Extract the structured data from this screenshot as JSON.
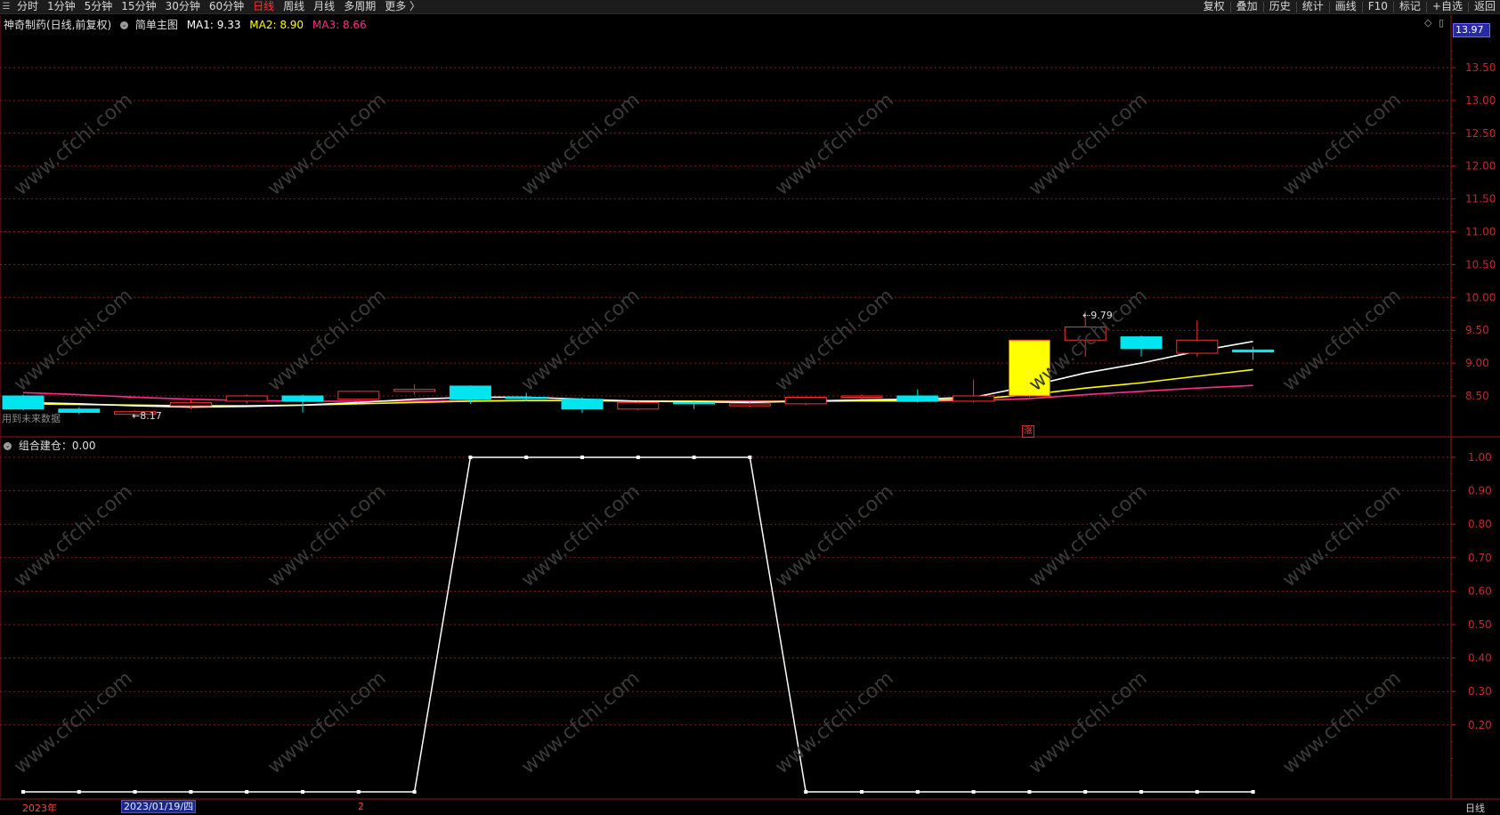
{
  "toolbar": {
    "periods": [
      "分时",
      "1分钟",
      "5分钟",
      "15分钟",
      "30分钟",
      "60分钟",
      "日线",
      "周线",
      "月线",
      "多周期",
      "更多 〉"
    ],
    "active_index": 6,
    "right_items": [
      "复权",
      "叠加",
      "历史",
      "统计",
      "画线",
      "F10",
      "标记",
      "+自选",
      "返回"
    ]
  },
  "main_panel": {
    "stock_title": "神奇制药(日线,前复权)",
    "chart_name": "简单主图",
    "ma1_label": "MA1: 9.33",
    "ma2_label": "MA2: 8.90",
    "ma3_label": "MA3: 8.66",
    "high_marker": "9.79",
    "low_marker": "8.17",
    "future_data_note": "用到未来数据",
    "current_price_tag": "13.97",
    "rise_tag": "涨",
    "colors": {
      "ma1": "#ffffff",
      "ma2": "#ffff00",
      "ma3": "#ff2a8a",
      "up": "#ff3030",
      "down": "#00e5ee",
      "limit_up": "#ffff00"
    }
  },
  "sub_panel": {
    "indicator_label": "组合建仓：0.00"
  },
  "bottom_bar": {
    "year_label": "2023年",
    "cursor_date": "2023/01/19/四",
    "marker_2": "2",
    "period_label": "日线"
  },
  "watermark": "www.cfchi.com",
  "chart_data": [
    {
      "type": "candlestick",
      "title": "神奇制药(日线,前复权)",
      "y_axis_ticks": [
        8.5,
        9.0,
        9.5,
        10.0,
        10.5,
        11.0,
        11.5,
        12.0,
        12.5,
        13.0,
        13.5
      ],
      "ylim": [
        8.0,
        14.0
      ],
      "candles": [
        {
          "o": 8.3,
          "c": 8.5,
          "h": 8.52,
          "l": 8.28,
          "dir": "down"
        },
        {
          "o": 8.3,
          "c": 8.25,
          "h": 8.33,
          "l": 8.22,
          "dir": "down"
        },
        {
          "o": 8.22,
          "c": 8.26,
          "h": 8.28,
          "l": 8.17,
          "dir": "up"
        },
        {
          "o": 8.35,
          "c": 8.4,
          "h": 8.45,
          "l": 8.3,
          "dir": "up"
        },
        {
          "o": 8.42,
          "c": 8.5,
          "h": 8.52,
          "l": 8.38,
          "dir": "up"
        },
        {
          "o": 8.5,
          "c": 8.42,
          "h": 8.52,
          "l": 8.25,
          "dir": "down"
        },
        {
          "o": 8.45,
          "c": 8.57,
          "h": 8.58,
          "l": 8.4,
          "dir": "up"
        },
        {
          "o": 8.57,
          "c": 8.6,
          "h": 8.68,
          "l": 8.52,
          "dir": "up"
        },
        {
          "o": 8.65,
          "c": 8.45,
          "h": 8.66,
          "l": 8.38,
          "dir": "down"
        },
        {
          "o": 8.48,
          "c": 8.46,
          "h": 8.55,
          "l": 8.42,
          "dir": "down"
        },
        {
          "o": 8.45,
          "c": 8.3,
          "h": 8.48,
          "l": 8.24,
          "dir": "down"
        },
        {
          "o": 8.3,
          "c": 8.4,
          "h": 8.42,
          "l": 8.28,
          "dir": "up"
        },
        {
          "o": 8.4,
          "c": 8.39,
          "h": 8.42,
          "l": 8.3,
          "dir": "down"
        },
        {
          "o": 8.35,
          "c": 8.38,
          "h": 8.4,
          "l": 8.33,
          "dir": "up"
        },
        {
          "o": 8.38,
          "c": 8.48,
          "h": 8.49,
          "l": 8.36,
          "dir": "up"
        },
        {
          "o": 8.48,
          "c": 8.5,
          "h": 8.52,
          "l": 8.45,
          "dir": "up"
        },
        {
          "o": 8.5,
          "c": 8.42,
          "h": 8.6,
          "l": 8.4,
          "dir": "down"
        },
        {
          "o": 8.42,
          "c": 8.5,
          "h": 8.75,
          "l": 8.4,
          "dir": "up"
        },
        {
          "o": 8.5,
          "c": 9.35,
          "h": 9.35,
          "l": 8.48,
          "dir": "limit"
        },
        {
          "o": 9.35,
          "c": 9.55,
          "h": 9.79,
          "l": 9.1,
          "dir": "up"
        },
        {
          "o": 9.4,
          "c": 9.22,
          "h": 9.42,
          "l": 9.1,
          "dir": "down"
        },
        {
          "o": 9.15,
          "c": 9.35,
          "h": 9.65,
          "l": 9.1,
          "dir": "up"
        },
        {
          "o": 9.2,
          "c": 9.17,
          "h": 9.25,
          "l": 9.05,
          "dir": "down"
        }
      ],
      "ma1": [
        8.4,
        8.38,
        8.35,
        8.33,
        8.34,
        8.36,
        8.4,
        8.45,
        8.48,
        8.48,
        8.45,
        8.42,
        8.41,
        8.4,
        8.42,
        8.44,
        8.45,
        8.48,
        8.65,
        8.85,
        9.0,
        9.18,
        9.33
      ],
      "ma2": [
        8.38,
        8.37,
        8.36,
        8.35,
        8.35,
        8.36,
        8.38,
        8.4,
        8.42,
        8.43,
        8.43,
        8.42,
        8.42,
        8.41,
        8.42,
        8.43,
        8.43,
        8.45,
        8.52,
        8.62,
        8.7,
        8.8,
        8.9
      ],
      "ma3": [
        8.55,
        8.52,
        8.48,
        8.45,
        8.43,
        8.42,
        8.42,
        8.42,
        8.43,
        8.43,
        8.43,
        8.42,
        8.42,
        8.42,
        8.42,
        8.42,
        8.42,
        8.43,
        8.46,
        8.52,
        8.57,
        8.62,
        8.66
      ]
    },
    {
      "type": "line",
      "title": "组合建仓",
      "y_axis_ticks": [
        0.2,
        0.3,
        0.4,
        0.5,
        0.6,
        0.7,
        0.8,
        0.9,
        1.0
      ],
      "ylim": [
        0.0,
        1.0
      ],
      "values": [
        0,
        0,
        0,
        0,
        0,
        0,
        0,
        0,
        1,
        1,
        1,
        1,
        1,
        1,
        0,
        0,
        0,
        0,
        0,
        0,
        0,
        0,
        0
      ]
    }
  ]
}
